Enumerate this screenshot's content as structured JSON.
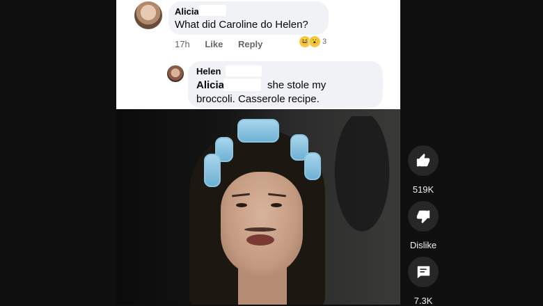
{
  "facebook_thread": {
    "comment": {
      "author": "Alicia",
      "text": "What did Caroline do Helen?",
      "time": "17h",
      "like_label": "Like",
      "reply_label": "Reply",
      "reaction_count": "3"
    },
    "reply": {
      "author": "Helen",
      "mention": "Alicia",
      "text_line1": "she stole my",
      "text_line2": "broccoli. Casserole recipe."
    }
  },
  "actions": {
    "like_count": "519K",
    "dislike_label": "Dislike",
    "comments_count": "7.3K"
  },
  "icons": {
    "like": "thumbs-up-icon",
    "dislike": "thumbs-down-icon",
    "comments": "comment-icon"
  },
  "colors": {
    "background": "#0f0f0f",
    "action_circle": "#272727",
    "bubble": "#f0f2f5"
  }
}
